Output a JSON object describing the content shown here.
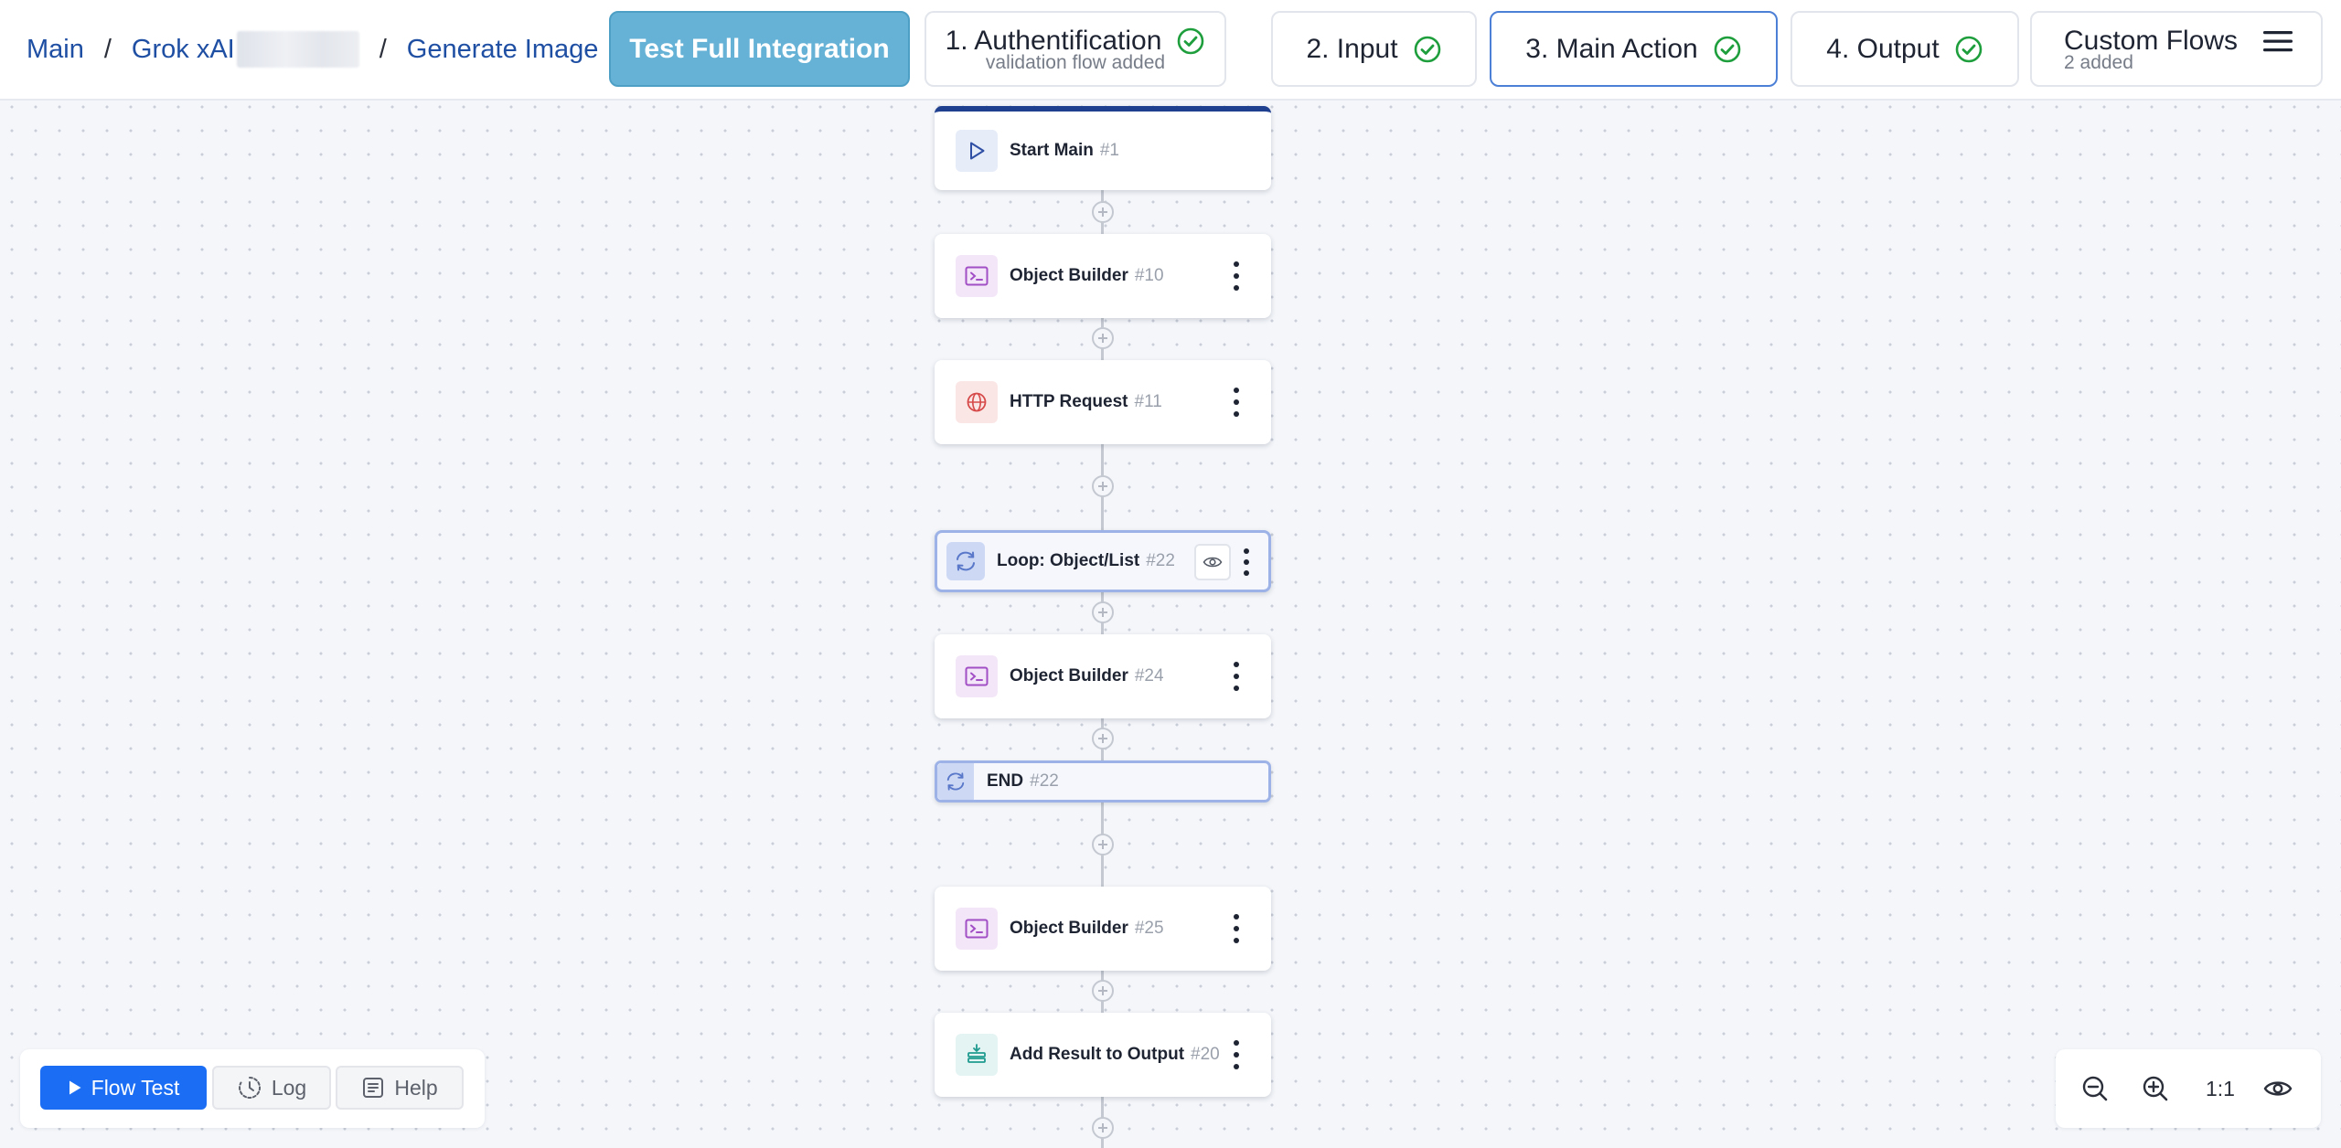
{
  "breadcrumb": {
    "main": "Main",
    "integration": "Grok xAI",
    "action": "Generate Image"
  },
  "header": {
    "test_full_label": "Test Full Integration",
    "steps": [
      {
        "label": "1. Authentification",
        "sub": "validation flow added",
        "status": "complete"
      },
      {
        "label": "2. Input",
        "status": "complete"
      },
      {
        "label": "3. Main Action",
        "status": "complete",
        "active": true
      },
      {
        "label": "4. Output",
        "status": "complete"
      },
      {
        "label": "Custom Flows",
        "sub": "2 added"
      }
    ]
  },
  "flow": {
    "start": {
      "name": "Start Main",
      "num": "#1"
    },
    "obj10": {
      "name": "Object Builder",
      "num": "#10"
    },
    "http11": {
      "name": "HTTP Request",
      "num": "#11"
    },
    "loop22": {
      "name": "Loop: Object/List",
      "num": "#22"
    },
    "obj24": {
      "name": "Object Builder",
      "num": "#24"
    },
    "end22": {
      "name": "END",
      "num": "#22"
    },
    "obj25": {
      "name": "Object Builder",
      "num": "#25"
    },
    "add20": {
      "name": "Add Result to Output",
      "num": "#20"
    }
  },
  "toolbar": {
    "flow_test": "Flow Test",
    "log": "Log",
    "help": "Help",
    "zoom": "1:1"
  },
  "colors": {
    "accent": "#1b6ef3",
    "test_button": "#65b2d6",
    "check": "#1e9e3c",
    "link": "#1f4fa3"
  }
}
